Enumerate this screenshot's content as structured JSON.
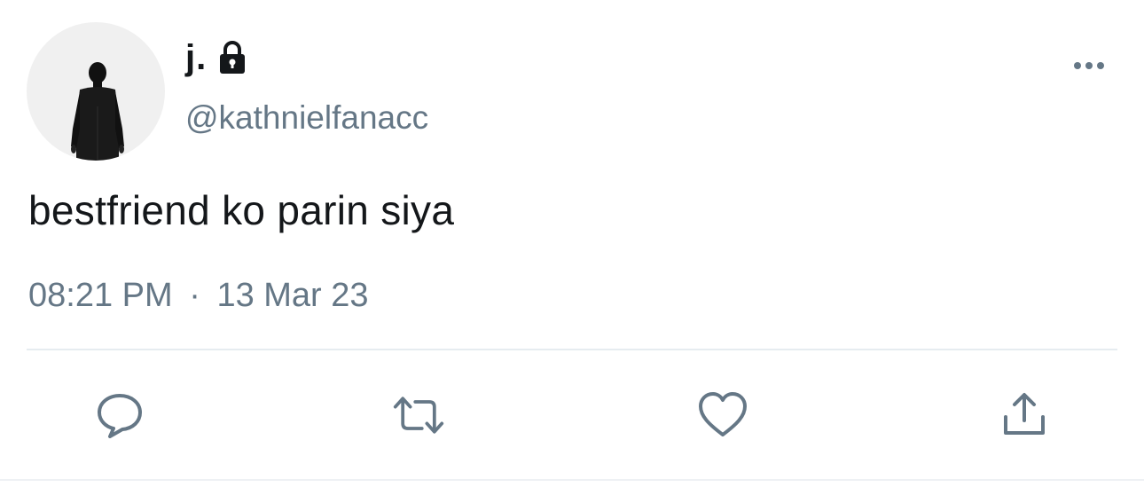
{
  "author": {
    "display_name": "j.",
    "handle": "@kathnielfanacc",
    "avatar_icon": "person-silhouette-avatar",
    "protected_icon": "lock-icon"
  },
  "tweet": {
    "text": "bestfriend ko parin siya",
    "time": "08:21 PM",
    "separator": "·",
    "date": "13 Mar 23"
  },
  "actions": {
    "reply_icon": "reply-icon",
    "retweet_icon": "retweet-icon",
    "like_icon": "heart-icon",
    "share_icon": "share-icon",
    "more_icon": "more-options-icon"
  },
  "colors": {
    "text_primary": "#14171a",
    "text_secondary": "#657786",
    "icon_color": "#657786",
    "divider": "#e6ecf0"
  }
}
